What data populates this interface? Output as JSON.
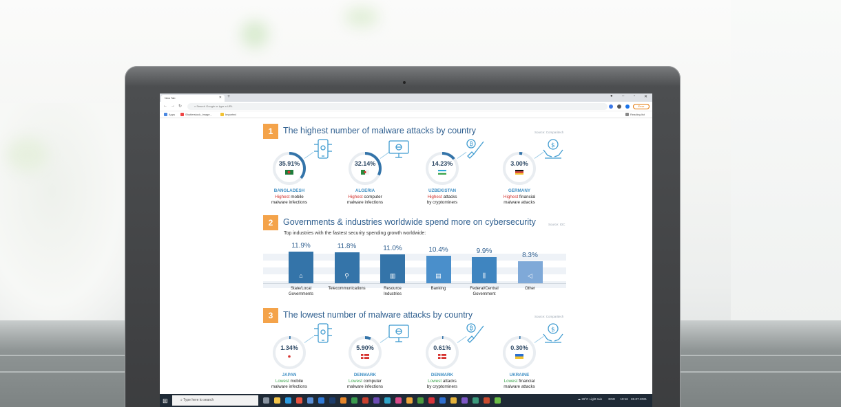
{
  "browser": {
    "tab_title": "New Tab",
    "omnibox_placeholder": "Search Google or type a URL",
    "update_label": "Error",
    "bookmarks": [
      "Apps",
      "Shutterstock_Image...",
      "Imported"
    ],
    "reading_list": "Reading list"
  },
  "section1": {
    "number": "1",
    "title": "The highest number of malware attacks by country",
    "source": "Source: Comparitech",
    "cards": [
      {
        "value": "35.91%",
        "fraction": 0.3591,
        "flag": "bangladesh-flag",
        "icon": "mobile-bug-icon",
        "country": "BANGLADESH",
        "highlight": "Highest",
        "line1_rest": " mobile",
        "line2": "malware infections"
      },
      {
        "value": "32.14%",
        "fraction": 0.3214,
        "flag": "algeria-flag",
        "icon": "computer-bug-icon",
        "country": "ALGERIA",
        "highlight": "Highest",
        "line1_rest": " computer",
        "line2": "malware infections"
      },
      {
        "value": "14.23%",
        "fraction": 0.1423,
        "flag": "uzbekistan-flag",
        "icon": "bitcoin-shovel-icon",
        "country": "UZBEKISTAN",
        "highlight": "Highest",
        "line1_rest": " attacks",
        "line2": "by cryptominers"
      },
      {
        "value": "3.00%",
        "fraction": 0.03,
        "flag": "germany-flag",
        "icon": "money-hands-icon",
        "country": "GERMANY",
        "highlight": "Highest",
        "line1_rest": " financial",
        "line2": "malware attacks"
      }
    ]
  },
  "section2": {
    "number": "2",
    "title": "Governments & industries worldwide spend more on cybersecurity",
    "source": "Source: IDC",
    "subtitle": "Top industries with the fastest security spending growth worldwide:"
  },
  "chart_data": {
    "type": "bar",
    "title": "Top industries with the fastest security spending growth worldwide:",
    "categories": [
      "State/Local Governments",
      "Telecommunications",
      "Resource Industries",
      "Banking",
      "Federal/Central Government",
      "Other"
    ],
    "values": [
      11.9,
      11.8,
      11.0,
      10.4,
      9.9,
      8.3
    ],
    "value_labels": [
      "11.9%",
      "11.8%",
      "11.0%",
      "10.4%",
      "9.9%",
      "8.3%"
    ],
    "category_lines": [
      [
        "State/Local",
        "Governments"
      ],
      [
        "Telecommunications",
        ""
      ],
      [
        "Resource",
        "Industries"
      ],
      [
        "Banking",
        ""
      ],
      [
        "Federal/Central",
        "Government"
      ],
      [
        "Other",
        ""
      ]
    ],
    "icons": [
      "government-building-icon",
      "cell-tower-icon",
      "factory-icon",
      "money-stack-icon",
      "columns-building-icon",
      "megaphone-icon"
    ],
    "colors": [
      "#3474a9",
      "#3474a9",
      "#3474a9",
      "#4a8fcb",
      "#3f85c0",
      "#7fa9d8"
    ],
    "ylim": [
      0,
      12
    ]
  },
  "section3": {
    "number": "3",
    "title": "The lowest number of malware attacks by country",
    "source": "Source: Comparitech",
    "cards": [
      {
        "value": "1.34%",
        "fraction": 0.0134,
        "flag": "japan-flag",
        "icon": "mobile-bug-icon",
        "country": "JAPAN",
        "highlight": "Lowest",
        "line1_rest": " mobile",
        "line2": "malware infections"
      },
      {
        "value": "5.90%",
        "fraction": 0.059,
        "flag": "denmark-flag",
        "icon": "computer-bug-icon",
        "country": "DENMARK",
        "highlight": "Lowest",
        "line1_rest": " computer",
        "line2": "malware infections"
      },
      {
        "value": "0.61%",
        "fraction": 0.0061,
        "flag": "denmark-flag",
        "icon": "bitcoin-shovel-icon",
        "country": "DENMARK",
        "highlight": "Lowest",
        "line1_rest": " attacks",
        "line2": "by cryptominers"
      },
      {
        "value": "0.30%",
        "fraction": 0.003,
        "flag": "ukraine-flag",
        "icon": "money-hands-icon",
        "country": "UKRAINE",
        "highlight": "Lowest",
        "line1_rest": " financial",
        "line2": "malware attacks"
      }
    ]
  },
  "taskbar": {
    "search_placeholder": "Type here to search",
    "weather": "26°C Light rain",
    "lang": "ENG",
    "time": "10:16",
    "date": "26-07-2021"
  },
  "colors": {
    "accent_orange": "#f4a34a",
    "title_blue": "#2f5f8f",
    "ring_blue": "#3474a9",
    "highest_red": "#d0302c",
    "lowest_green": "#3aa34a"
  }
}
